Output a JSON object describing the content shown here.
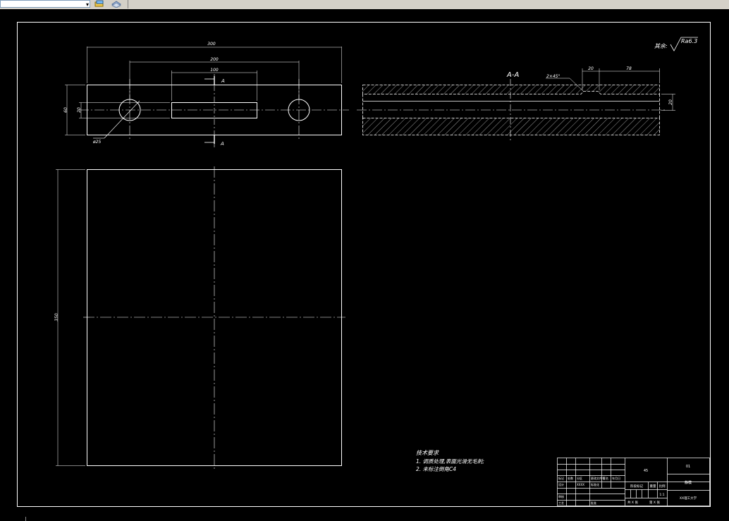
{
  "toolbar": {
    "layer_combo_value": "",
    "icons": [
      "layer-props-icon",
      "layer-state-icon"
    ]
  },
  "drawing": {
    "background": "#000000",
    "line_color": "#ffffff",
    "front_view": {
      "dim_overall_width": "300",
      "dim_hole_spacing": "200",
      "dim_slot_length": "100",
      "dim_height": "60",
      "dim_slot_height": "20",
      "hole_label": "ø25",
      "section_mark_top": "A",
      "section_mark_bottom": "A"
    },
    "section_view": {
      "title": "A-A",
      "chamfer_label": "2×45°",
      "dim_left": "20",
      "dim_right": "78",
      "dim_thickness": "20"
    },
    "plan_view": {
      "dim_height": "350"
    },
    "roughness": {
      "prefix": "其余:",
      "value": "Ra6.3"
    },
    "technical_requirements": {
      "title": "技术要求",
      "items": [
        "1. 调质处理,表面光滑无毛刺;",
        "2. 未标注倒角C4"
      ]
    },
    "title_block": {
      "material": "45",
      "drawing_no": "01",
      "part_name": "静模",
      "scale": "1:1",
      "company": "XX理工大学",
      "stage_label": "阶段标记",
      "weight_label": "重量",
      "scale_label": "比例",
      "sheet_total": "共 X 张",
      "sheet_no": "第 X 张",
      "row_labels": [
        "标记",
        "设计",
        "审核",
        "工艺"
      ],
      "col_labels": [
        "处数",
        "分区",
        "更改文件号",
        "签名",
        "年月日"
      ],
      "designer": "XXXX",
      "standardization": "标准化",
      "approve": "批准"
    }
  }
}
